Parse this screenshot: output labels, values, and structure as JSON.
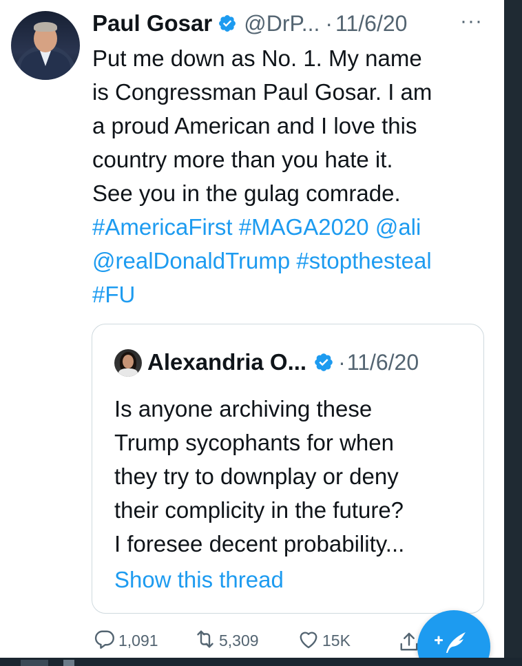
{
  "tweet": {
    "author_name": "Paul Gosar",
    "handle": "@DrP...",
    "separator": "·",
    "date": "11/6/20",
    "more": "···",
    "lines": [
      "Put me down as No. 1.  My name",
      "is Congressman Paul Gosar.  I am",
      "a proud American and I love this",
      "country more than you hate it.",
      "See you in the gulag comrade."
    ],
    "hashtags": {
      "line1": [
        "#AmericaFirst",
        "#MAGA2020",
        "@ali"
      ],
      "line2": [
        "@realDonaldTrump",
        "#stopthesteal"
      ],
      "line3": [
        "#FU"
      ]
    }
  },
  "quote": {
    "author_name": "Alexandria O...",
    "separator": "·",
    "date": "11/6/20",
    "lines": [
      "Is anyone archiving these",
      "Trump sycophants for when",
      "they try to downplay or deny",
      "their complicity in the future?",
      "I foresee decent probability..."
    ],
    "show_thread": "Show this thread"
  },
  "actions": {
    "replies": "1,091",
    "retweets": "5,309",
    "likes": "15K"
  },
  "colors": {
    "accent": "#1d9bf0",
    "text": "#0f1419",
    "secondary": "#536471",
    "border": "#cfd9de"
  },
  "icons": {
    "verified": "verified-badge-icon",
    "reply": "reply-icon",
    "retweet": "retweet-icon",
    "like": "heart-icon",
    "share": "share-icon",
    "compose": "compose-tweet-icon"
  }
}
